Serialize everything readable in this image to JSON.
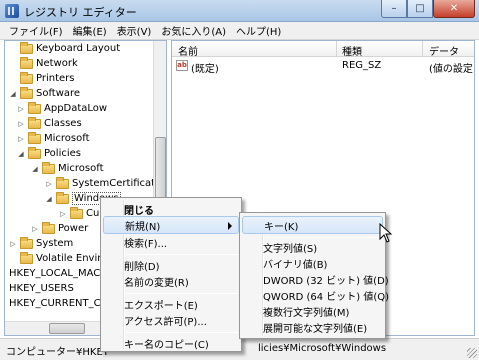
{
  "window": {
    "title": "レジストリ エディター",
    "buttons": {
      "minimize": "–",
      "maximize": "□",
      "close": "✕"
    }
  },
  "menubar": [
    "ファイル(F)",
    "編集(E)",
    "表示(V)",
    "お気に入り(A)",
    "ヘルプ(H)"
  ],
  "tree": {
    "items": [
      {
        "label": "Keyboard Layout",
        "expander": ""
      },
      {
        "label": "Network",
        "expander": ""
      },
      {
        "label": "Printers",
        "expander": ""
      },
      {
        "label": "Software",
        "expander": "◢"
      },
      {
        "label": "AppDataLow",
        "expander": "▷"
      },
      {
        "label": "Classes",
        "expander": "▷"
      },
      {
        "label": "Microsoft",
        "expander": "▷"
      },
      {
        "label": "Policies",
        "expander": "◢"
      },
      {
        "label": "Microsoft",
        "expander": "◢"
      },
      {
        "label": "SystemCertificates",
        "expander": "▷"
      },
      {
        "label": "Windows",
        "expander": "◢"
      },
      {
        "label": "Cur",
        "expander": "▷"
      },
      {
        "label": "Power",
        "expander": "▷"
      },
      {
        "label": "System",
        "expander": "▷"
      },
      {
        "label": "Volatile Environm",
        "expander": ""
      },
      {
        "label": "HKEY_LOCAL_MAC",
        "expander": ""
      },
      {
        "label": "HKEY_USERS",
        "expander": ""
      },
      {
        "label": "HKEY_CURRENT_CO",
        "expander": ""
      }
    ]
  },
  "list": {
    "columns": [
      "名前",
      "種類",
      "データ"
    ],
    "rows": [
      {
        "name": "(既定)",
        "type": "REG_SZ",
        "data": "(値の設定"
      }
    ]
  },
  "statusbar": {
    "path_left": "コンピューター¥HKEY",
    "path_right": "licies¥Microsoft¥Windows"
  },
  "context_menu": {
    "items": [
      "閉じる",
      "新規(N)",
      "検索(F)...",
      "削除(D)",
      "名前の変更(R)",
      "エクスポート(E)",
      "アクセス許可(P)...",
      "キー名のコピー(C)"
    ]
  },
  "submenu": {
    "items": [
      "キー(K)",
      "文字列値(S)",
      "バイナリ値(B)",
      "DWORD (32 ビット) 値(D)",
      "QWORD (64 ビット) 値(Q)",
      "複数行文字列値(M)",
      "展開可能な文字列値(E)"
    ]
  },
  "icons": {
    "app": "registry-editor-icon",
    "folder": "folder-icon",
    "string_value": "string-value-icon",
    "cursor": "mouse-cursor-icon"
  }
}
